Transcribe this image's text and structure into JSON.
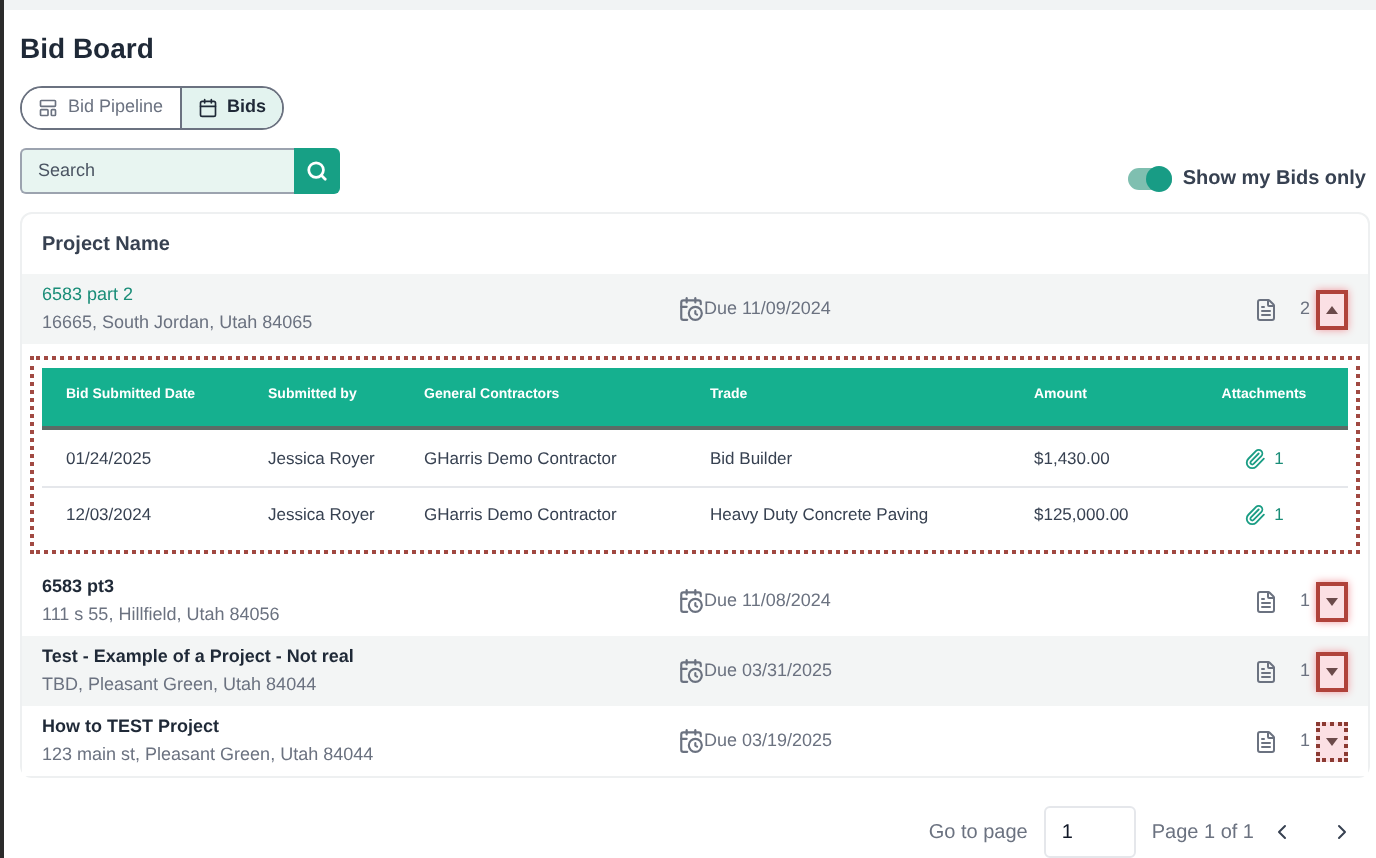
{
  "title": "Bid Board",
  "tabs": [
    {
      "label": "Bid Pipeline",
      "selected": false
    },
    {
      "label": "Bids",
      "selected": true
    }
  ],
  "search": {
    "placeholder": "Search"
  },
  "my_bids_toggle": {
    "label": "Show my Bids only",
    "on": true
  },
  "table": {
    "column": "Project Name",
    "projects": [
      {
        "name": "6583 part 2",
        "address": "16665, South Jordan, Utah 84065",
        "due": "Due 11/09/2024",
        "count": "2",
        "expanded": true,
        "annotation_dotted": false,
        "bids": {
          "columns": [
            "Bid Submitted Date",
            "Submitted by",
            "General Contractors",
            "Trade",
            "Amount",
            "Attachments"
          ],
          "rows": [
            {
              "date": "01/24/2025",
              "by": "Jessica Royer",
              "contractor": "GHarris Demo Contractor",
              "trade": "Bid Builder",
              "amount": "$1,430.00",
              "attachments": "1"
            },
            {
              "date": "12/03/2024",
              "by": "Jessica Royer",
              "contractor": "GHarris Demo Contractor",
              "trade": "Heavy Duty Concrete Paving",
              "amount": "$125,000.00",
              "attachments": "1"
            }
          ]
        }
      },
      {
        "name": "6583 pt3",
        "address": "111 s 55, Hillfield, Utah 84056",
        "due": "Due 11/08/2024",
        "count": "1",
        "expanded": false,
        "annotation_dotted": false
      },
      {
        "name": "Test - Example of a Project - Not real",
        "address": "TBD, Pleasant Green, Utah 84044",
        "due": "Due 03/31/2025",
        "count": "1",
        "expanded": false,
        "annotation_dotted": false
      },
      {
        "name": "How to TEST Project",
        "address": "123 main st, Pleasant Green, Utah 84044",
        "due": "Due 03/19/2025",
        "count": "1",
        "expanded": false,
        "annotation_dotted": true
      }
    ]
  },
  "pagination": {
    "go_to_label": "Go to page",
    "page_value": "1",
    "page_info": "Page 1 of 1"
  }
}
